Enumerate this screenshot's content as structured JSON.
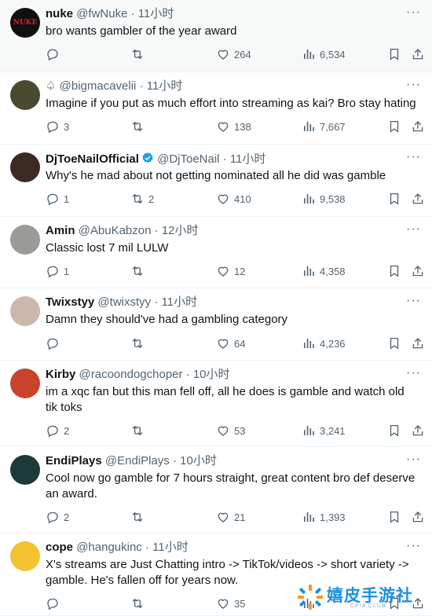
{
  "tweets": [
    {
      "name": "nuke",
      "handle": "@fwNuke",
      "dot": "·",
      "time": "11小时",
      "text": "bro wants gambler of the year award",
      "reply": "",
      "retweet": "",
      "like": "264",
      "views": "6,534",
      "avatar_color": "#101010",
      "avatar_text": "NUKE",
      "highlight": true
    },
    {
      "name": "♤",
      "handle": "@bigmacavelii",
      "dot": "·",
      "time": "11小时",
      "text": "Imagine if you put as much effort into streaming as kai? Bro stay hating",
      "reply": "3",
      "retweet": "",
      "like": "138",
      "views": "7,667",
      "avatar_color": "#4a4a2e",
      "avatar_text": "",
      "highlight": false
    },
    {
      "name": "DjToeNailOfficial",
      "handle": "@DjToeNail",
      "dot": "·",
      "time": "11小时",
      "text": "Why's he mad about not getting nominated all he did was gamble",
      "reply": "1",
      "retweet": "2",
      "like": "410",
      "views": "9,538",
      "avatar_color": "#3d2a22",
      "avatar_text": "",
      "highlight": false,
      "verified": true
    },
    {
      "name": "Amin",
      "handle": "@AbuKabzon",
      "dot": "·",
      "time": "12小时",
      "text": "Classic lost 7 mil LULW",
      "reply": "1",
      "retweet": "",
      "like": "12",
      "views": "4,358",
      "avatar_color": "#9a9a96",
      "avatar_text": "",
      "highlight": false
    },
    {
      "name": "Twixstyy",
      "handle": "@twixstyy",
      "dot": "·",
      "time": "11小时",
      "text": "Damn they should've had a gambling category",
      "reply": "",
      "retweet": "",
      "like": "64",
      "views": "4,236",
      "avatar_color": "#cdb7ac",
      "avatar_text": "",
      "highlight": false
    },
    {
      "name": "Kirby",
      "handle": "@racoondogchoper",
      "dot": "·",
      "time": "10小时",
      "text": "im a xqc fan but this man fell off, all he does is gamble and watch old tik toks",
      "reply": "2",
      "retweet": "",
      "like": "53",
      "views": "3,241",
      "avatar_color": "#c8432a",
      "avatar_text": "",
      "highlight": false
    },
    {
      "name": "EndiPlays",
      "handle": "@EndiPlays",
      "dot": "·",
      "time": "10小时",
      "text": "Cool now go gamble for 7 hours straight, great content bro def deserve an award.",
      "reply": "2",
      "retweet": "",
      "like": "21",
      "views": "1,393",
      "avatar_color": "#1c3a3a",
      "avatar_text": "",
      "highlight": false
    },
    {
      "name": "cope",
      "handle": "@hangukinc",
      "dot": "·",
      "time": "11小时",
      "text": "X's streams are Just Chatting intro -> TikTok/videos -> short variety -> gamble. He's fallen off for years now.",
      "reply": "",
      "retweet": "",
      "like": "35",
      "views": "",
      "avatar_color": "#f2c230",
      "avatar_text": "",
      "highlight": false
    }
  ],
  "more_label": "···",
  "watermark": {
    "text": "嬉皮手游社",
    "sub": "CPIA CLUB"
  },
  "colors": {
    "text": "#0f1419",
    "secondary": "#536471",
    "divider": "#eff3f4",
    "verified": "#1d9bf0"
  }
}
